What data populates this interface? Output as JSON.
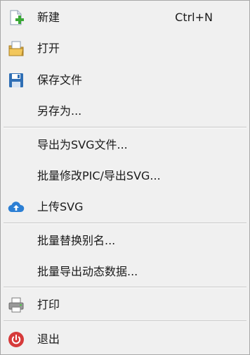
{
  "menu": {
    "items": [
      {
        "label": "新建",
        "shortcut": "Ctrl+N",
        "icon": "new-file-icon"
      },
      {
        "label": "打开",
        "icon": "open-folder-icon"
      },
      {
        "label": "保存文件",
        "icon": "save-icon"
      },
      {
        "label": "另存为..."
      },
      {
        "label": "导出为SVG文件..."
      },
      {
        "label": "批量修改PIC/导出SVG..."
      },
      {
        "label": "上传SVG",
        "icon": "cloud-upload-icon"
      },
      {
        "label": "批量替换别名..."
      },
      {
        "label": "批量导出动态数据..."
      },
      {
        "label": "打印",
        "icon": "printer-icon"
      },
      {
        "label": "退出",
        "icon": "power-icon"
      }
    ]
  }
}
